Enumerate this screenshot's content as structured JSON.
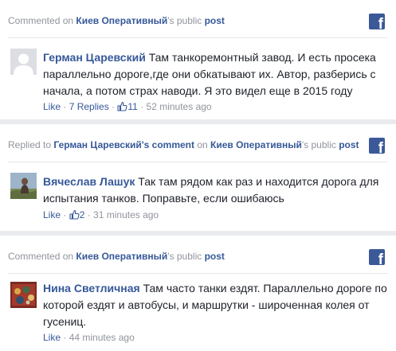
{
  "cards": [
    {
      "header": {
        "prefix": "Commented on ",
        "page": "Киев Оперативный",
        "suffix": "'s public ",
        "post": "post"
      },
      "author": "Герман Царевский",
      "text": "Там танкоремонтный завод. И есть просека параллельно дороге,где они обкатывают их. Автор, разберись с начала, а потом страх наводи. Я это видел еще в 2015 году",
      "actions": {
        "like": "Like",
        "dot1": " · ",
        "replies": "7 Replies",
        "dot2": " · ",
        "like_count": "11",
        "dot3": " · ",
        "time": "52 minutes ago"
      }
    },
    {
      "header": {
        "prefix": "Replied to ",
        "target": "Герман Царевский's comment",
        "mid": " on ",
        "page": "Киев Оперативный",
        "suffix": "'s public ",
        "post": "post"
      },
      "author": "Вячеслав Лашук",
      "text": "Так там рядом как раз и находится дорога для испытания танков. Поправьте, если ошибаюсь",
      "actions": {
        "like": "Like",
        "dot1": " · ",
        "like_count": "2",
        "dot2": " · ",
        "time": "31 minutes ago"
      }
    },
    {
      "header": {
        "prefix": "Commented on ",
        "page": "Киев Оперативный",
        "suffix": "'s public ",
        "post": "post"
      },
      "author": "Нина Светличная",
      "text": "Там часто танки ездят. Параллельно дороге по которой ездят и автобусы, и маршрутки - широченная колея от гусениц.",
      "actions": {
        "like": "Like",
        "dot1": " · ",
        "time": "44 minutes ago"
      }
    }
  ],
  "icons": {
    "facebook": "facebook-icon",
    "like": "thumbs-up-icon",
    "avatar_placeholder": "default-avatar-icon"
  },
  "colors": {
    "link": "#365899",
    "meta": "#90949c",
    "text": "#1d2129",
    "background": "#e9ebee",
    "facebook": "#3b5998"
  }
}
